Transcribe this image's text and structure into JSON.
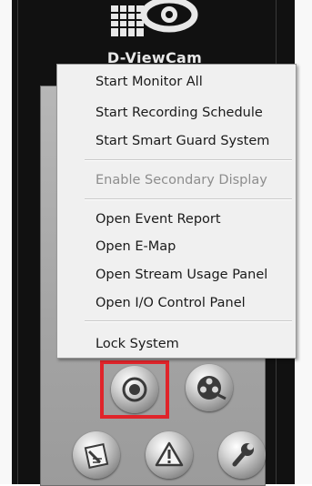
{
  "logo": {
    "text": "D-ViewCam",
    "icon": "eye-camera-logo-icon"
  },
  "menu": {
    "items": [
      {
        "label": "Start Monitor All",
        "enabled": true
      },
      {
        "label": "Start Recording Schedule",
        "enabled": true
      },
      {
        "label": "Start Smart Guard System",
        "enabled": true
      },
      {
        "label": "Enable Secondary Display",
        "enabled": false
      },
      {
        "label": "Open Event Report",
        "enabled": true
      },
      {
        "label": "Open E-Map",
        "enabled": true
      },
      {
        "label": "Open Stream Usage Panel",
        "enabled": true
      },
      {
        "label": "Open I/O Control Panel",
        "enabled": true
      },
      {
        "label": "Lock System",
        "enabled": true
      }
    ]
  },
  "toolbar": {
    "buttons": [
      {
        "icon": "record-icon",
        "highlighted": true
      },
      {
        "icon": "film-reel-icon",
        "highlighted": false
      },
      {
        "icon": "edit-document-icon",
        "highlighted": false
      },
      {
        "icon": "warning-icon",
        "highlighted": false
      },
      {
        "icon": "wrench-icon",
        "highlighted": false
      }
    ]
  },
  "colors": {
    "highlight": "#e0242a",
    "dark_panel": "#111111",
    "menu_background": "#f0f0f0",
    "disabled_text": "#8d8d8d"
  }
}
